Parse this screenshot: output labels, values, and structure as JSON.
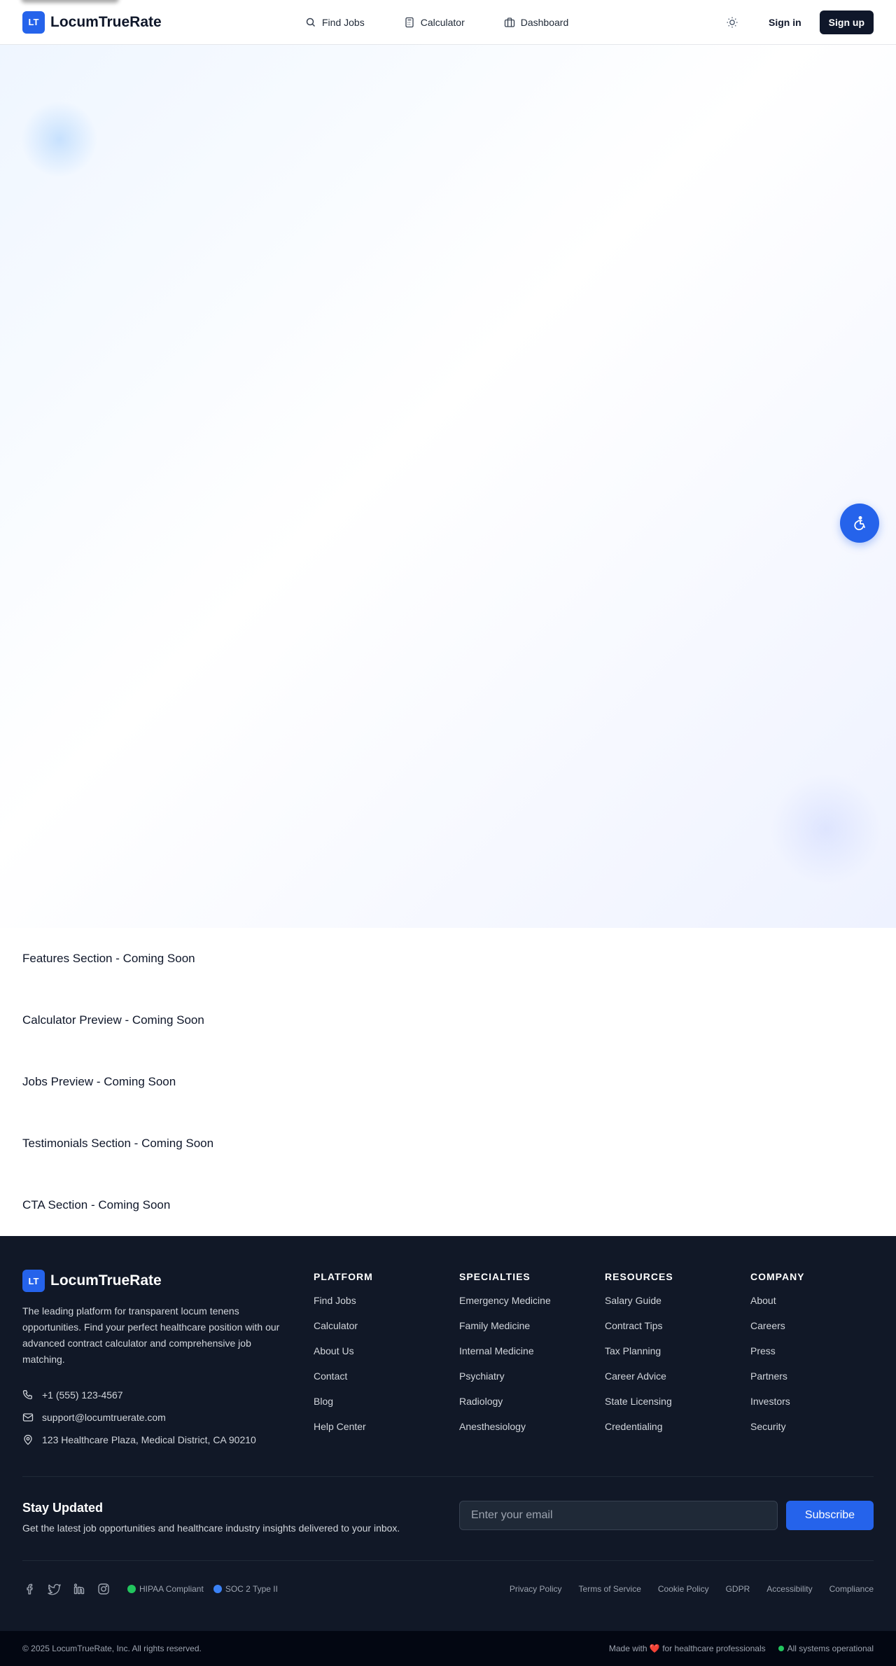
{
  "header": {
    "logo_mark": "LT",
    "logo_text": "LocumTrueRate",
    "nav": [
      {
        "label": "Find Jobs",
        "icon": "search-icon"
      },
      {
        "label": "Calculator",
        "icon": "calculator-icon"
      },
      {
        "label": "Dashboard",
        "icon": "briefcase-icon"
      }
    ],
    "theme_icon": "sun-icon",
    "signin_label": "Sign in",
    "signup_label": "Sign up"
  },
  "accessibility_button_icon": "accessibility-icon",
  "sections": [
    "Features Section - Coming Soon",
    "Calculator Preview - Coming Soon",
    "Jobs Preview - Coming Soon",
    "Testimonials Section - Coming Soon",
    "CTA Section - Coming Soon"
  ],
  "footer": {
    "logo_mark": "LT",
    "logo_text": "LocumTrueRate",
    "description": "The leading platform for transparent locum tenens opportunities. Find your perfect healthcare position with our advanced contract calculator and comprehensive job matching.",
    "phone": "+1 (555) 123-4567",
    "email": "support@locumtruerate.com",
    "address": "123 Healthcare Plaza, Medical District, CA 90210",
    "columns": [
      {
        "title": "PLATFORM",
        "links": [
          "Find Jobs",
          "Calculator",
          "About Us",
          "Contact",
          "Blog",
          "Help Center"
        ]
      },
      {
        "title": "SPECIALTIES",
        "links": [
          "Emergency Medicine",
          "Family Medicine",
          "Internal Medicine",
          "Psychiatry",
          "Radiology",
          "Anesthesiology"
        ]
      },
      {
        "title": "RESOURCES",
        "links": [
          "Salary Guide",
          "Contract Tips",
          "Tax Planning",
          "Career Advice",
          "State Licensing",
          "Credentialing"
        ]
      },
      {
        "title": "COMPANY",
        "links": [
          "About",
          "Careers",
          "Press",
          "Partners",
          "Investors",
          "Security"
        ]
      }
    ],
    "newsletter": {
      "title": "Stay Updated",
      "subtitle": "Get the latest job opportunities and healthcare industry insights delivered to your inbox.",
      "placeholder": "Enter your email",
      "button": "Subscribe"
    },
    "socials": [
      "facebook-icon",
      "twitter-icon",
      "linkedin-icon",
      "instagram-icon"
    ],
    "badges": [
      {
        "label": "HIPAA Compliant",
        "color": "#22c55e"
      },
      {
        "label": "SOC 2 Type II",
        "color": "#3b82f6"
      }
    ],
    "legal": [
      "Privacy Policy",
      "Terms of Service",
      "Cookie Policy",
      "GDPR",
      "Accessibility",
      "Compliance"
    ],
    "copyright": "© 2025 LocumTrueRate, Inc. All rights reserved.",
    "made_with_prefix": "Made with",
    "made_with_heart": "❤️",
    "made_with_suffix": "for healthcare professionals",
    "status": "All systems operational",
    "status_color": "#22c55e"
  },
  "colors": {
    "brand": "#2563eb",
    "dark": "#0f172a",
    "footer_bg": "#111827"
  }
}
